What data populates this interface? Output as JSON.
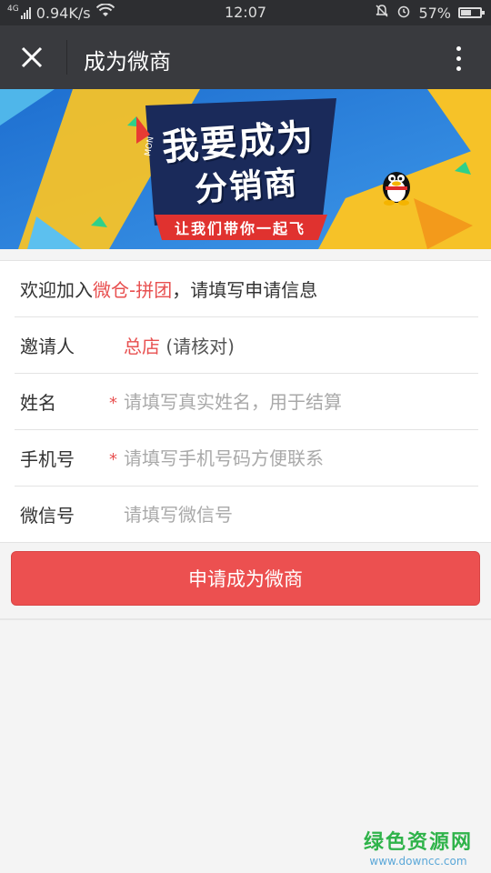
{
  "status_bar": {
    "network": "4G",
    "speed": "0.94K/s",
    "time": "12:07",
    "battery": "57%",
    "battery_level": 0.57,
    "icons": [
      "signal-icon",
      "wifi-icon",
      "mute-icon",
      "alarm-icon",
      "battery-icon"
    ]
  },
  "titlebar": {
    "title": "成为微商",
    "close_icon": "close-icon",
    "more_icon": "more-vertical-icon"
  },
  "banner": {
    "headline_1": "我要成为",
    "headline_2": "分销商",
    "sub": "让我们带你一起飞",
    "tag": "MON"
  },
  "form": {
    "welcome_prefix": "欢迎加入",
    "welcome_brand": "微仓-拼团",
    "welcome_suffix": "，请填写申请信息",
    "inviter_label": "邀请人",
    "inviter_name": "总店",
    "inviter_note": " (请核对)",
    "name_label": "姓名",
    "name_placeholder": "请填写真实姓名，用于结算",
    "phone_label": "手机号",
    "phone_placeholder": "请填写手机号码方便联系",
    "wechat_label": "微信号",
    "wechat_placeholder": "请填写微信号",
    "required_mark": "*"
  },
  "submit_label": "申请成为微商",
  "watermark": {
    "title": "绿色资源网",
    "url": "www.downcc.com"
  },
  "colors": {
    "accent": "#ec5050",
    "titlebar": "#393a3e",
    "statusbar": "#2d2e31"
  }
}
